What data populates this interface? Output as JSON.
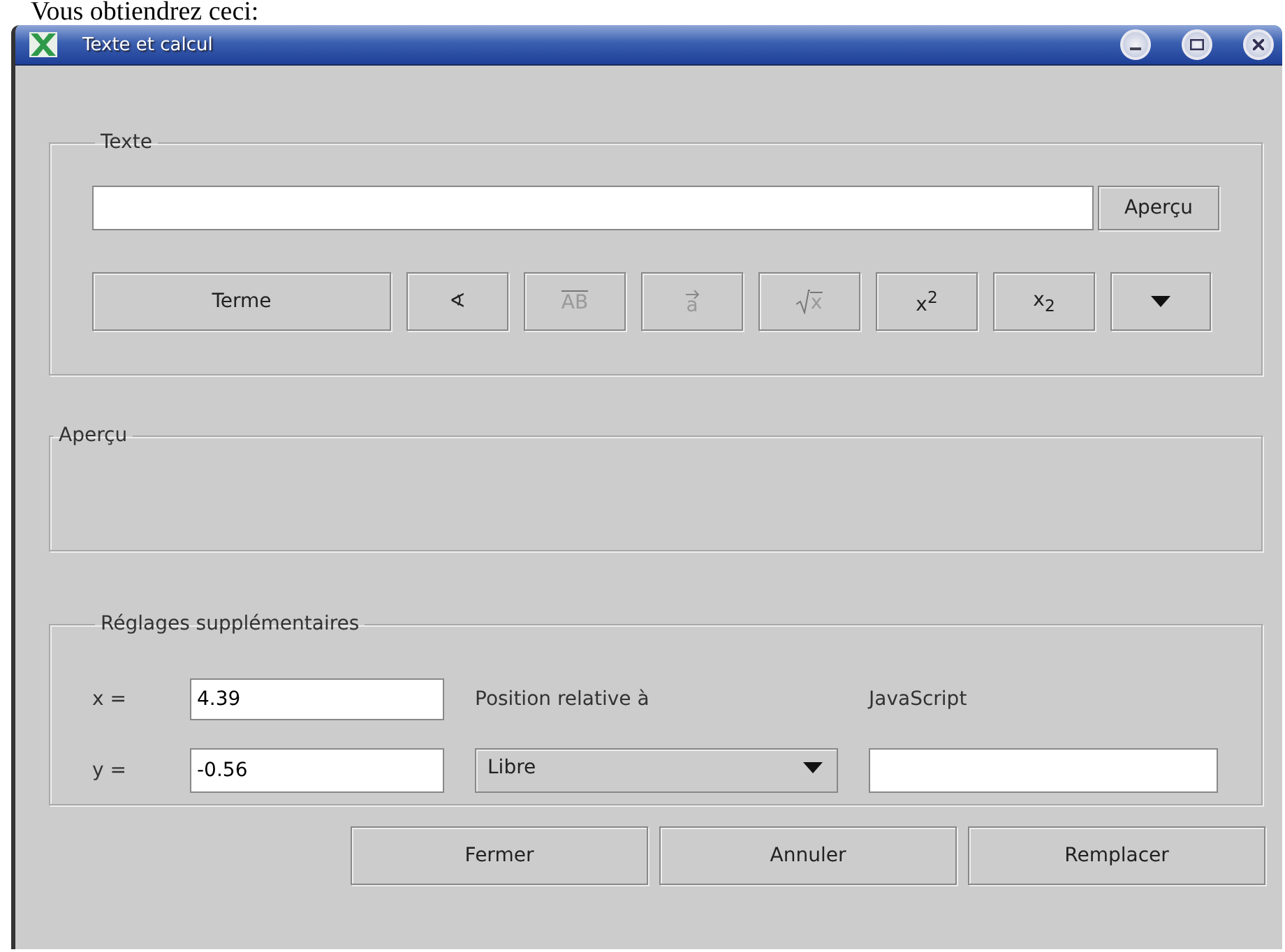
{
  "caption": "Vous obtiendrez ceci:",
  "window": {
    "title": "Texte et calcul"
  },
  "text_section": {
    "legend": "Texte",
    "preview_button": "Aperçu",
    "tools": [
      {
        "kind": "text",
        "label": "Terme",
        "disabled": false
      },
      {
        "kind": "text",
        "label": "∢",
        "disabled": false
      },
      {
        "kind": "overline",
        "label": "AB",
        "disabled": true
      },
      {
        "kind": "vector",
        "label": "a",
        "disabled": true
      },
      {
        "kind": "sqrt",
        "label": "x",
        "disabled": true
      },
      {
        "kind": "script",
        "label": "x$^{2}$",
        "disabled": false
      },
      {
        "kind": "script",
        "label": "x$_{2}$",
        "disabled": false
      },
      {
        "kind": "menu",
        "disabled": false
      }
    ]
  },
  "preview_section": {
    "legend": "Aperçu"
  },
  "settings": {
    "legend": "Réglages supplémentaires",
    "x": {
      "label": "x =",
      "value": "4.39"
    },
    "y": {
      "label": "y =",
      "value": "-0.56"
    },
    "position": {
      "label": "Position relative à",
      "value": "Libre"
    },
    "javascript": {
      "label": "JavaScript"
    }
  },
  "buttons": [
    "Fermer",
    "Annuler",
    "Remplacer"
  ]
}
